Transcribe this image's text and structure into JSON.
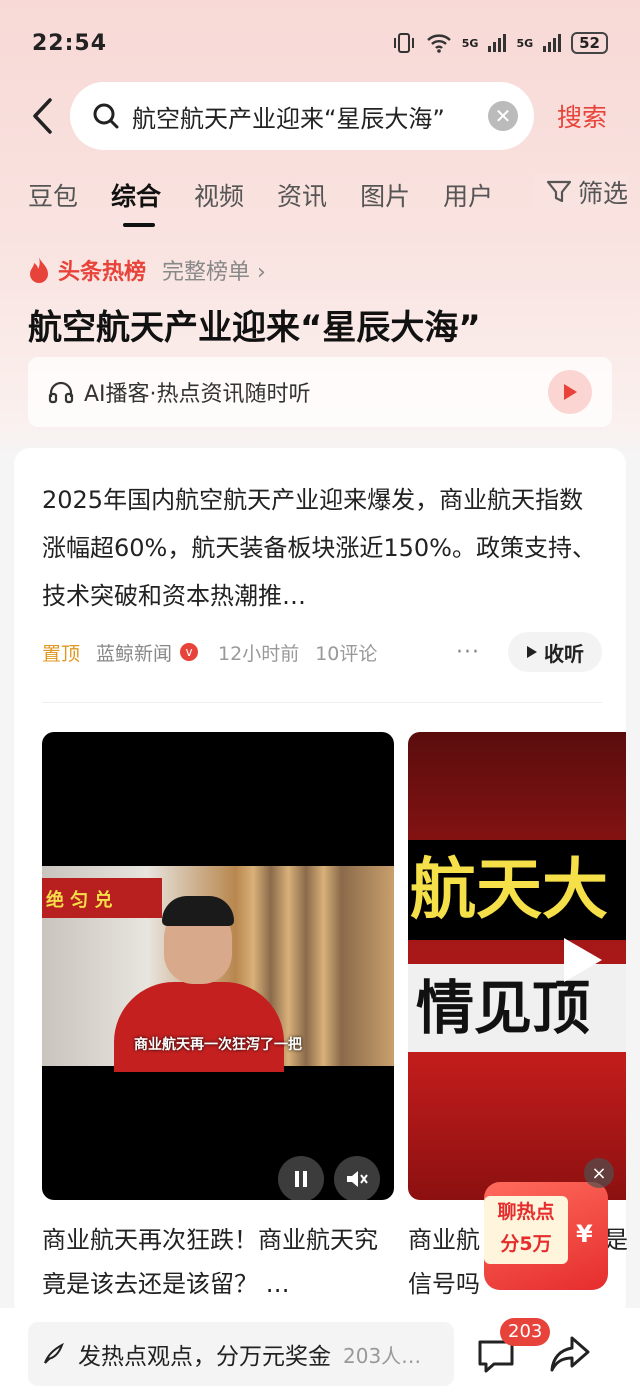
{
  "status_bar": {
    "time": "22:54",
    "battery": "52",
    "net1": "5G",
    "net2": "5G"
  },
  "search": {
    "query": "航空航天产业迎来“星辰大海”",
    "submit_label": "搜索"
  },
  "tabs": [
    {
      "label": "豆包"
    },
    {
      "label": "综合"
    },
    {
      "label": "视频"
    },
    {
      "label": "资讯"
    },
    {
      "label": "图片"
    },
    {
      "label": "用户"
    }
  ],
  "filter_label": "筛选",
  "hot_list": {
    "label": "头条热榜",
    "full_link": "完整榜单 ›",
    "headline": "航空航天产业迎来“星辰大海”"
  },
  "podcast": {
    "label": "AI播客·热点资讯随时听"
  },
  "article": {
    "text": "2025年国内航空航天产业迎来爆发，商业航天指数涨幅超60%，航天装备板块涨近150%。政策支持、技术突破和资本热潮推…",
    "pin": "置顶",
    "source": "蓝鲸新闻",
    "verified": "v",
    "time": "12小时前",
    "comments": "10评论",
    "more": "···",
    "listen_label": "收听"
  },
  "videos": [
    {
      "sign_text": "绝 匀 兑",
      "subtitle": "商业航天再一次狂泻了一把",
      "caption": "商业航天再次狂跌！商业航天究竟是该去还是该留？ …"
    },
    {
      "line1": "航天大",
      "line2": "情见顶",
      "caption": "商业航",
      "caption_line2": "信号吗",
      "caption_tail": "是"
    }
  ],
  "promo": {
    "line1": "聊热点",
    "line2": "分5万",
    "yen": "¥",
    "close": "×"
  },
  "bottom": {
    "comment_placeholder": "发热点观点，分万元奖金",
    "comment_count": "203人…",
    "badge": "203"
  }
}
